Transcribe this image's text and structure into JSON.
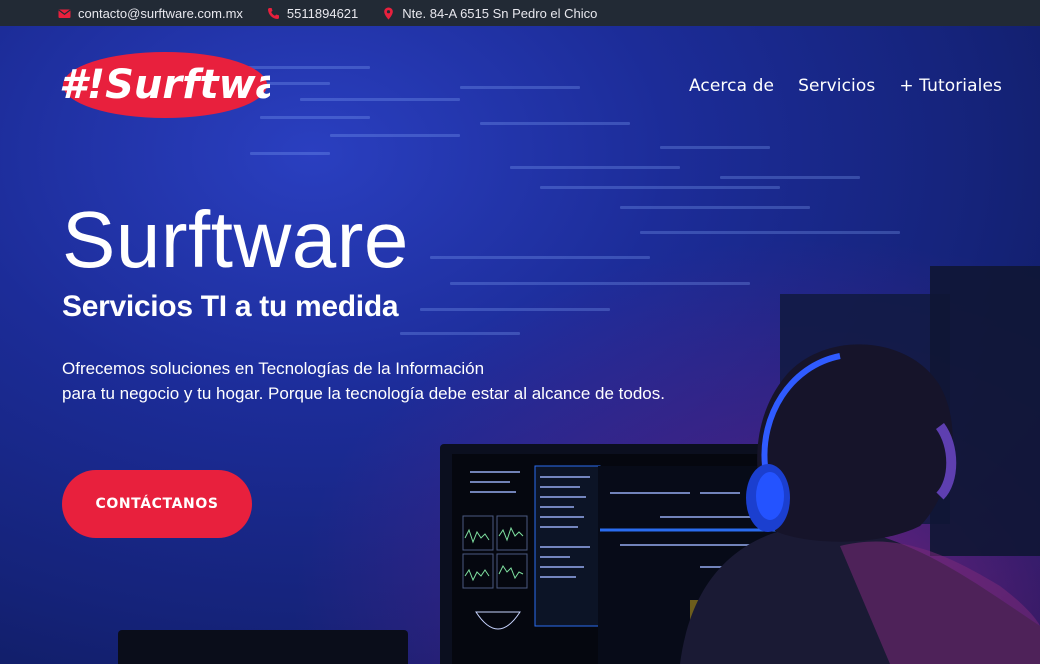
{
  "topbar": {
    "email": "contacto@surftware.com.mx",
    "phone": "5511894621",
    "address": "Nte. 84-A 6515 Sn Pedro el Chico",
    "icons": {
      "email": "envelope-icon",
      "phone": "phone-icon",
      "address": "map-pin-icon"
    }
  },
  "logo": {
    "text": "#!Surftware"
  },
  "nav": {
    "items": [
      {
        "label": "Acerca de"
      },
      {
        "label": "Servicios"
      },
      {
        "label": "+ Tutoriales"
      }
    ]
  },
  "hero": {
    "title": "Surftware",
    "subtitle": "Servicios TI a tu medida",
    "description_line1": "Ofrecemos soluciones en Tecnologías de la Información",
    "description_line2": "para tu negocio y tu hogar. Porque la tecnología debe estar al alcance de todos.",
    "cta_label": "CONTÁCTANOS"
  },
  "colors": {
    "accent": "#e8203d",
    "topbar_bg": "#222a35",
    "hero_blue": "#1c2c98"
  }
}
